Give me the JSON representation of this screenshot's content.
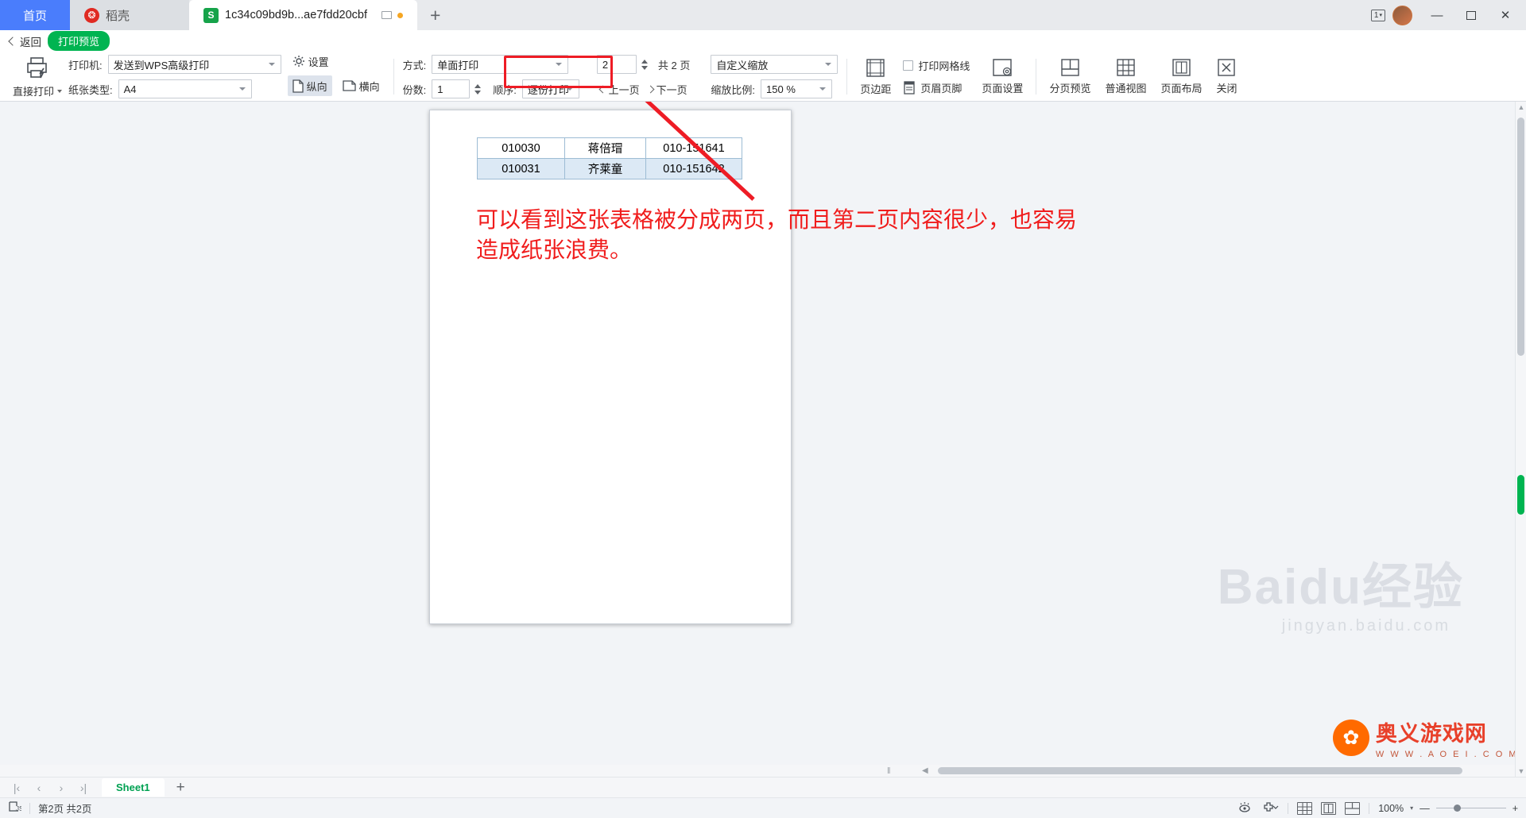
{
  "window": {
    "tabs": [
      {
        "label": "首页",
        "icon": "home-tab"
      },
      {
        "label": "稻壳",
        "icon": "daoke-logo-icon"
      },
      {
        "label": "1c34c09bd9b...ae7fdd20cbf",
        "icon": "spreadsheet-icon"
      }
    ],
    "new_tab_label": "+",
    "window_count": "1",
    "minimize": "—",
    "maximize": "▫",
    "close": "✕"
  },
  "backbar": {
    "back_label": "返回",
    "mode_badge": "打印预览"
  },
  "ribbon": {
    "direct_print": "直接打印",
    "printer_label": "打印机:",
    "printer_value": "发送到WPS高级打印",
    "paper_label": "纸张类型:",
    "paper_value": "A4",
    "portrait": "纵向",
    "landscape": "横向",
    "settings": "设置",
    "method_label": "方式:",
    "method_value": "单面打印",
    "copies_label": "份数:",
    "copies_value": "1",
    "order_label": "顺序:",
    "order_value": "逐份打印",
    "page_number": "2",
    "page_total": "共 2 页",
    "prev_page": "上一页",
    "next_page": "下一页",
    "scale_mode": "自定义缩放",
    "scale_label": "缩放比例:",
    "scale_value": "150 %",
    "margins": "页边距",
    "gridlines": "打印网格线",
    "header_footer": "页眉页脚",
    "page_setup": "页面设置",
    "page_break_preview": "分页预览",
    "normal_view": "普通视图",
    "page_layout": "页面布局",
    "close": "关闭"
  },
  "document": {
    "table": {
      "rows": [
        [
          "010030",
          "蒋倍瑁",
          "010-151641"
        ],
        [
          "010031",
          "齐莱童",
          "010-151642"
        ]
      ]
    },
    "annotation": "可以看到这张表格被分成两页，而且第二页内容很少，也容易造成纸张浪费。"
  },
  "watermark": {
    "baidu": "Baidu经验",
    "baidu_sub": "jingyan.baidu.com",
    "aoyou_title": "奥义游戏网",
    "aoyou_url": "W W W . A O E I . C O M"
  },
  "sheetbar": {
    "first": "|‹",
    "prev": "‹",
    "next": "›",
    "last": "›|",
    "sheet_name": "Sheet1",
    "add_sheet": "+"
  },
  "statusbar": {
    "page_status": "第2页 共2页",
    "zoom_level": "100%",
    "minus": "—",
    "plus": "+"
  },
  "colors": {
    "accent_blue": "#4a7dfc",
    "accent_green": "#00b451",
    "highlight_red": "#ee1c25",
    "annotation_red": "#f01c1c",
    "table_border": "#9dbcd4",
    "table_alt_row": "#dce9f5"
  }
}
